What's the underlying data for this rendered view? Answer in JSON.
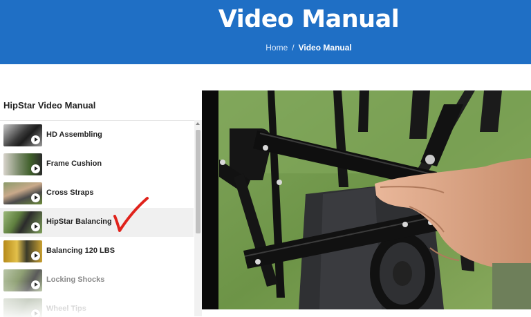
{
  "header": {
    "title": "Video Manual",
    "breadcrumb": {
      "home": "Home",
      "separator": "/",
      "current": "Video Manual"
    }
  },
  "playlist": {
    "title": "HipStar Video Manual",
    "items": [
      {
        "label": "HD Assembling",
        "active": false
      },
      {
        "label": "Frame Cushion",
        "active": false
      },
      {
        "label": "Cross Straps",
        "active": false
      },
      {
        "label": "HipStar Balancing",
        "active": true
      },
      {
        "label": "Balancing 120 LBS",
        "active": false
      },
      {
        "label": "Locking Shocks",
        "active": false
      },
      {
        "label": "Wheel Tips",
        "active": false
      }
    ]
  },
  "annotation": {
    "mark": "checkmark",
    "color": "#e0221b"
  },
  "colors": {
    "header_bg": "#1f6fc5",
    "active_row": "#f0f0f0"
  }
}
